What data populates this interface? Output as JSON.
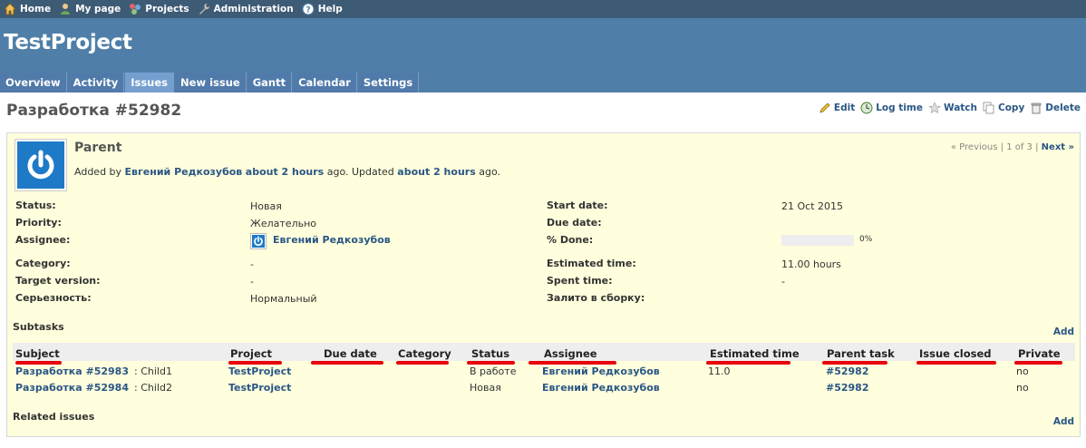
{
  "top_menu": {
    "items": [
      {
        "label": "Home",
        "icon": "home-icon"
      },
      {
        "label": "My page",
        "icon": "user-icon"
      },
      {
        "label": "Projects",
        "icon": "projects-icon"
      },
      {
        "label": "Administration",
        "icon": "wrench-icon"
      },
      {
        "label": "Help",
        "icon": "help-icon"
      }
    ]
  },
  "header": {
    "project_title": "TestProject",
    "tabs": [
      {
        "label": "Overview",
        "selected": false
      },
      {
        "label": "Activity",
        "selected": false
      },
      {
        "label": "Issues",
        "selected": true
      },
      {
        "label": "New issue",
        "selected": false
      },
      {
        "label": "Gantt",
        "selected": false
      },
      {
        "label": "Calendar",
        "selected": false
      },
      {
        "label": "Settings",
        "selected": false
      }
    ]
  },
  "contextual": {
    "edit": "Edit",
    "log_time": "Log time",
    "watch": "Watch",
    "copy": "Copy",
    "delete": "Delete"
  },
  "issue": {
    "title": "Разработка #52982",
    "subject": "Parent",
    "author_prefix": "Added by",
    "author": "Евгений Редкозубов",
    "added_ago": "about 2 hours",
    "ago_updated": "ago. Updated",
    "updated_ago": "about 2 hours",
    "ago_end": "ago.",
    "nav": {
      "previous": "« Previous",
      "sep1": "|",
      "position": "1 of 3",
      "sep2": "|",
      "next": "Next »"
    },
    "attributes": {
      "status_label": "Status:",
      "status": "Новая",
      "priority_label": "Priority:",
      "priority": "Желательно",
      "assignee_label": "Assignee:",
      "assignee": "Евгений Редкозубов",
      "category_label": "Category:",
      "category": "-",
      "target_label": "Target version:",
      "target": "-",
      "severity_label": "Серьезность:",
      "severity": "Нормальный",
      "start_label": "Start date:",
      "start": "21 Oct 2015",
      "due_label": "Due date:",
      "due": "",
      "done_label": "% Done:",
      "done": "0%",
      "done_fraction": 0,
      "estimated_label": "Estimated time:",
      "estimated": "11.00 hours",
      "spent_label": "Spent time:",
      "spent": "-",
      "build_label": "Залито в сборку:",
      "build": ""
    },
    "subtasks": {
      "title": "Subtasks",
      "add": "Add",
      "columns": [
        "Subject",
        "Project",
        "Due date",
        "Category",
        "Status",
        "Assignee",
        "Estimated time",
        "Parent task",
        "Issue closed",
        "Private"
      ],
      "rows": [
        {
          "subject_link": "Разработка #52983",
          "subject_rest": ": Child1",
          "project": "TestProject",
          "due": "",
          "category": "",
          "status": "В работе",
          "assignee": "Евгений Редкозубов",
          "estimated": "11.0",
          "parent": "#52982",
          "closed": "",
          "private": "no"
        },
        {
          "subject_link": "Разработка #52984",
          "subject_rest": ": Child2",
          "project": "TestProject",
          "due": "",
          "category": "",
          "status": "Новая",
          "assignee": "Евгений Редкозубов",
          "estimated": "",
          "parent": "#52982",
          "closed": "",
          "private": "no"
        }
      ]
    },
    "related": {
      "title": "Related issues",
      "add": "Add"
    }
  },
  "colors": {
    "top_menu_bg": "#3e5b76",
    "header_bg": "#4f7fa8",
    "issue_bg": "#ffffdd",
    "link": "#2a5685",
    "annotation_underline": "#e8000b"
  }
}
